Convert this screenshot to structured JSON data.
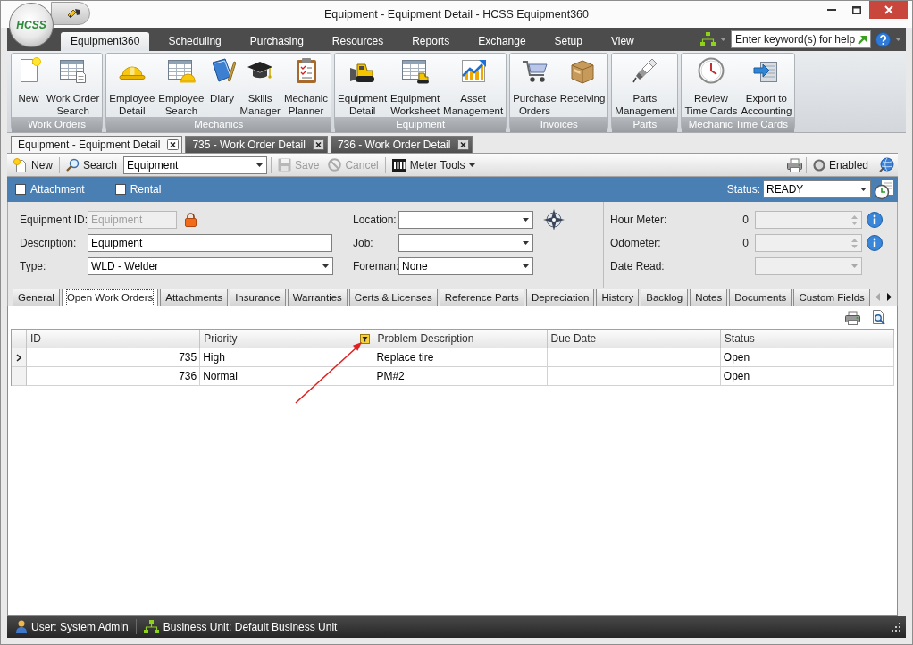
{
  "window": {
    "title": "Equipment - Equipment Detail - HCSS Equipment360",
    "logo_text": "HCSS"
  },
  "ribbon_tabs": [
    {
      "label": "Equipment360",
      "selected": true
    },
    {
      "label": "Scheduling",
      "selected": false
    },
    {
      "label": "Purchasing",
      "selected": false
    },
    {
      "label": "Resources",
      "selected": false
    },
    {
      "label": "Reports",
      "selected": false
    },
    {
      "label": "Exchange",
      "selected": false
    },
    {
      "label": "Setup",
      "selected": false
    },
    {
      "label": "View",
      "selected": false
    }
  ],
  "help_search": {
    "placeholder": "Enter keyword(s) for help"
  },
  "ribbon_groups": [
    {
      "label": "Work Orders",
      "buttons": [
        "New",
        "Work Order\nSearch"
      ]
    },
    {
      "label": "Mechanics",
      "buttons": [
        "Employee\nDetail",
        "Employee\nSearch",
        "Diary",
        "Skills\nManager",
        "Mechanic\nPlanner"
      ]
    },
    {
      "label": "Equipment",
      "buttons": [
        "Equipment\nDetail",
        "Equipment\nWorksheet",
        "Asset\nManagement"
      ]
    },
    {
      "label": "Invoices",
      "buttons": [
        "Purchase\nOrders",
        "Receiving"
      ]
    },
    {
      "label": "Parts",
      "buttons": [
        "Parts\nManagement"
      ]
    },
    {
      "label": "Mechanic Time Cards",
      "buttons": [
        "Review\nTime Cards",
        "Export to\nAccounting"
      ]
    }
  ],
  "document_tabs": [
    {
      "label": "Equipment - Equipment Detail",
      "selected": true
    },
    {
      "label": "735 - Work Order Detail",
      "selected": false
    },
    {
      "label": "736 - Work Order Detail",
      "selected": false
    }
  ],
  "toolbar": {
    "new": "New",
    "search": {
      "label": "Search",
      "value": "Equipment"
    },
    "actions": [
      {
        "label": "Save",
        "disabled": true
      },
      {
        "label": "Cancel",
        "disabled": true
      }
    ],
    "meter_tools": "Meter Tools",
    "enabled": "Enabled"
  },
  "record_bar": {
    "flags": [
      {
        "label": "Attachment",
        "checked": false
      },
      {
        "label": "Rental",
        "checked": false
      }
    ],
    "status": {
      "label": "Status:",
      "value": "READY"
    }
  },
  "form": {
    "left": [
      {
        "label": "Equipment ID:",
        "kind": "text",
        "value": "Equipment",
        "disabled": true,
        "locked": true
      },
      {
        "label": "Description:",
        "kind": "text",
        "value": "Equipment",
        "disabled": false,
        "locked": false
      },
      {
        "label": "Type:",
        "kind": "combo",
        "value": "WLD - Welder",
        "disabled": false,
        "locked": false
      }
    ],
    "middle": [
      {
        "label": "Location:",
        "kind": "combo"
      },
      {
        "label": "Job:",
        "kind": "combo"
      },
      {
        "label": "Foreman:",
        "kind": "combo",
        "value": "None"
      }
    ],
    "right": [
      {
        "label": "Hour Meter:",
        "kind": "spinner",
        "reading": "0",
        "disabled": true
      },
      {
        "label": "Odometer:",
        "kind": "spinner",
        "reading": "0",
        "disabled": true
      },
      {
        "label": "Date Read:",
        "kind": "combo",
        "disabled": true
      }
    ]
  },
  "detail_tabs": [
    {
      "label": "General",
      "selected": false
    },
    {
      "label": "Open Work Orders",
      "selected": true
    },
    {
      "label": "Attachments",
      "selected": false
    },
    {
      "label": "Insurance",
      "selected": false
    },
    {
      "label": "Warranties",
      "selected": false
    },
    {
      "label": "Certs & Licenses",
      "selected": false
    },
    {
      "label": "Reference Parts",
      "selected": false
    },
    {
      "label": "Depreciation",
      "selected": false
    },
    {
      "label": "History",
      "selected": false
    },
    {
      "label": "Backlog",
      "selected": false
    },
    {
      "label": "Notes",
      "selected": false
    },
    {
      "label": "Documents",
      "selected": false
    },
    {
      "label": "Custom Fields",
      "selected": false
    }
  ],
  "grid": {
    "columns": [
      "ID",
      "Priority",
      "Problem Description",
      "Due Date",
      "Status"
    ],
    "rows": [
      {
        "id": "735",
        "priority": "High",
        "problem_description": "Replace tire",
        "status": "Open",
        "current": true
      },
      {
        "id": "736",
        "priority": "Normal",
        "problem_description": "PM#2",
        "status": "Open",
        "current": false
      }
    ]
  },
  "status_bar": {
    "user": "User: System Admin",
    "business_unit": "Business Unit: Default Business Unit"
  }
}
